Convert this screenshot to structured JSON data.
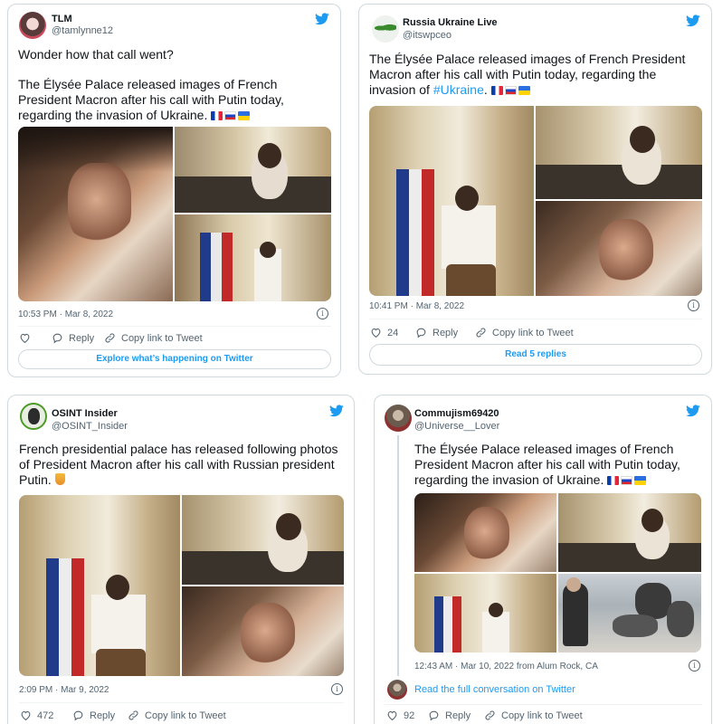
{
  "tweets": [
    {
      "name": "TLM",
      "handle": "@tamlynne12",
      "text1": "Wonder how that call went?",
      "text2": "The Élysée Palace released images of French President Macron after his call with Putin today, regarding the invasion of Ukraine.",
      "time": "10:53 PM · Mar 8, 2022",
      "reply_label": "Reply",
      "copy_label": "Copy link to Tweet",
      "cta": "Explore what’s happening on Twitter"
    },
    {
      "name": "Russia Ukraine Live",
      "handle": "@itswpceo",
      "text_before": "The Élysée Palace released images of French President Macron after his call with Putin today, regarding the invasion of ",
      "hashtag": "#Ukraine",
      "text_after": ".",
      "time": "10:41 PM · Mar 8, 2022",
      "likes": "24",
      "reply_label": "Reply",
      "copy_label": "Copy link to Tweet",
      "cta": "Read 5 replies"
    },
    {
      "name": "OSINT Insider",
      "handle": "@OSINT_Insider",
      "text": "French presidential palace has released following photos of President Macron after his call with Russian president Putin.",
      "time": "2:09 PM · Mar 9, 2022",
      "likes": "472",
      "reply_label": "Reply",
      "copy_label": "Copy link to Tweet"
    },
    {
      "name": "Commujism69420",
      "handle": "@Universe__Lover",
      "text": "The Élysée Palace released images of French President Macron after his call with Putin today, regarding the invasion of Ukraine.",
      "time": "12:43 AM · Mar 10, 2022 from Alum Rock, CA",
      "likes": "92",
      "reply_label": "Reply",
      "copy_label": "Copy link to Tweet",
      "cta": "Read the full conversation on Twitter"
    }
  ],
  "icons": {
    "twitter": "twitter-bird-icon",
    "heart": "heart-icon",
    "reply": "speech-bubble-icon",
    "copy": "link-icon",
    "info": "info-icon"
  },
  "colors": {
    "accent": "#1d9bf0",
    "border": "#cfd9de",
    "muted": "#536471"
  }
}
